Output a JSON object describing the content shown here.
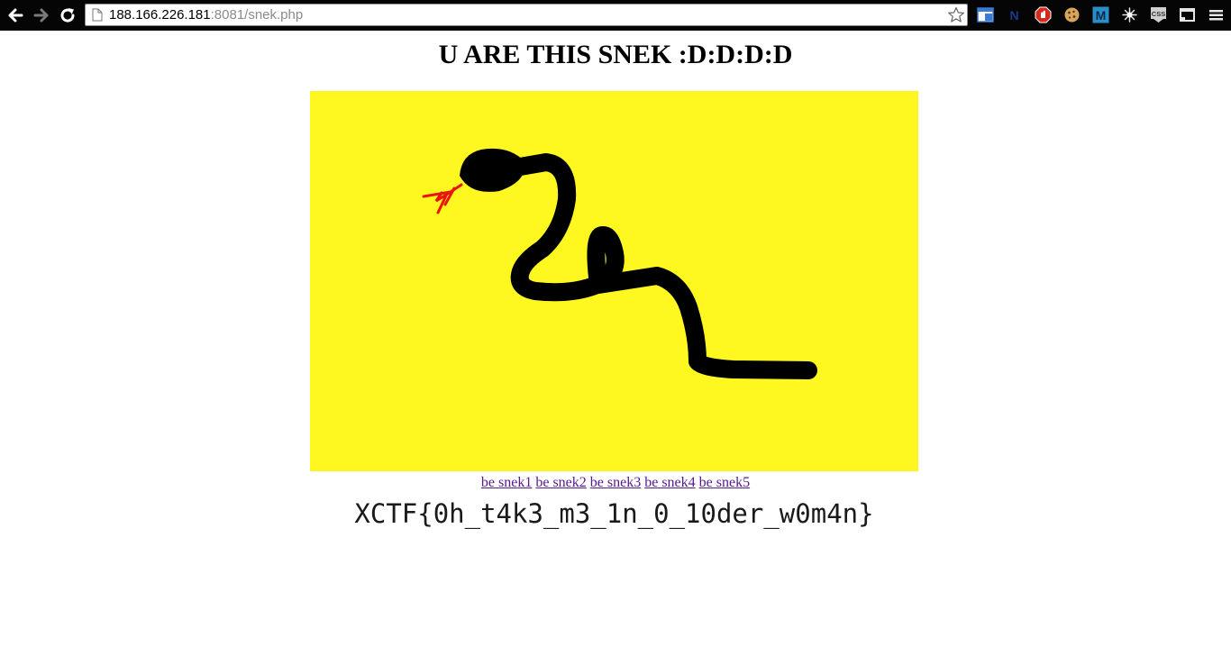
{
  "browser": {
    "url_host": "188.166.226.181",
    "url_rest": ":8081/snek.php",
    "icons": {
      "back": "back-arrow-icon",
      "forward": "forward-arrow-icon",
      "reload": "reload-icon",
      "page": "page-icon",
      "bookmark": "star-icon",
      "extensions": [
        "window-extension-icon",
        "n-extension-icon",
        "stop-extension-icon",
        "cookie-extension-icon",
        "m-extension-icon",
        "sparkle-extension-icon",
        "css-extension-icon",
        "cast-extension-icon",
        "menu-icon"
      ]
    },
    "extension_labels": {
      "n": "N",
      "m": "M",
      "css": "CSS"
    },
    "colors": {
      "toolbar": "#050505",
      "snek_bg": "#fef720",
      "tongue": "#e8160c",
      "link": "#551a8b"
    }
  },
  "page": {
    "title": "U ARE THIS SNEK :D:D:D:D",
    "image": {
      "flag_text": "XCTF{0h_t4k3_m3_1n_0_10der_w0m4n}"
    },
    "links": [
      "be snek1",
      "be snek2",
      "be snek3",
      "be snek4",
      "be snek5"
    ]
  }
}
